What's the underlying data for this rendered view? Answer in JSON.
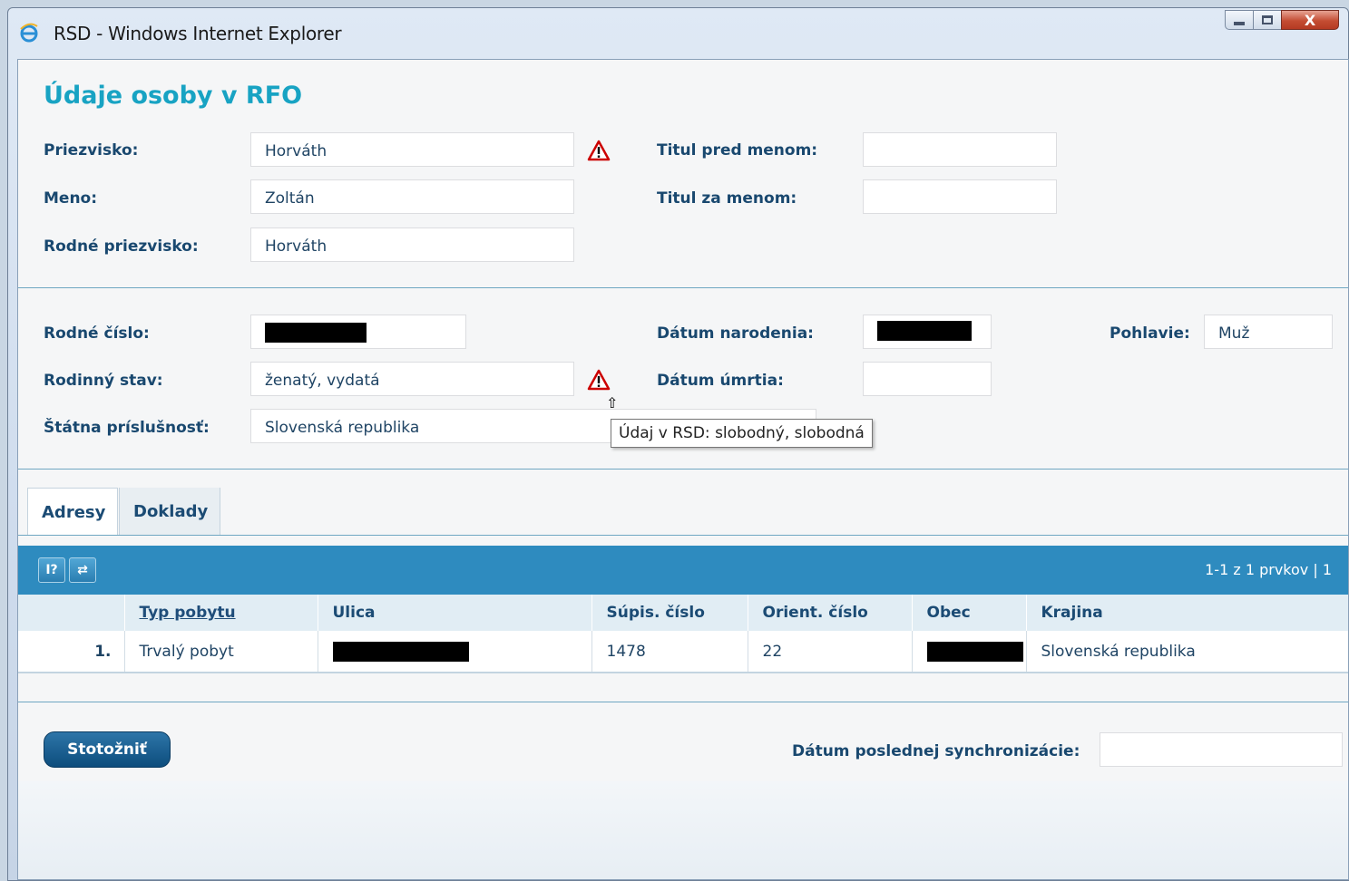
{
  "window": {
    "title": "RSD - Windows Internet Explorer",
    "close_glyph": "X"
  },
  "page": {
    "title": "Údaje osoby v RFO"
  },
  "person": {
    "priezvisko_label": "Priezvisko:",
    "priezvisko": "Horváth",
    "meno_label": "Meno:",
    "meno": "Zoltán",
    "rodne_priezvisko_label": "Rodné priezvisko:",
    "rodne_priezvisko": "Horváth",
    "titul_pred_label": "Titul pred menom:",
    "titul_pred": "",
    "titul_za_label": "Titul za menom:",
    "titul_za": ""
  },
  "details": {
    "rodne_cislo_label": "Rodné číslo:",
    "datum_narodenia_label": "Dátum narodenia:",
    "pohlavie_label": "Pohlavie:",
    "pohlavie": "Muž",
    "rodinny_stav_label": "Rodinný stav:",
    "rodinny_stav": "ženatý, vydatá",
    "datum_umrtia_label": "Dátum úmrtia:",
    "datum_umrtia": "",
    "statna_prislusnost_label": "Štátna príslušnosť:",
    "statna_prislusnost": "Slovenská republika"
  },
  "tooltip": {
    "text": "Údaj v RSD: slobodný, slobodná"
  },
  "tabs": [
    {
      "label": "Adresy"
    },
    {
      "label": "Doklady"
    }
  ],
  "grid": {
    "pager": "1-1 z 1 prvkov  |  1",
    "columns": [
      "Typ pobytu",
      "Ulica",
      "Súpis. číslo",
      "Orient. číslo",
      "Obec",
      "Krajina"
    ],
    "rows": [
      {
        "num": "1.",
        "typ": "Trvalý pobyt",
        "supis": "1478",
        "orient": "22",
        "krajina": "Slovenská republika"
      }
    ]
  },
  "footer": {
    "button_label": "Stotožniť",
    "sync_label": "Dátum poslednej synchronizácie:",
    "sync_value": ""
  },
  "colors": {
    "accent": "#18a3c3",
    "label": "#19486f",
    "gridbar": "#2e8bbf",
    "warning": "#cc0000"
  }
}
